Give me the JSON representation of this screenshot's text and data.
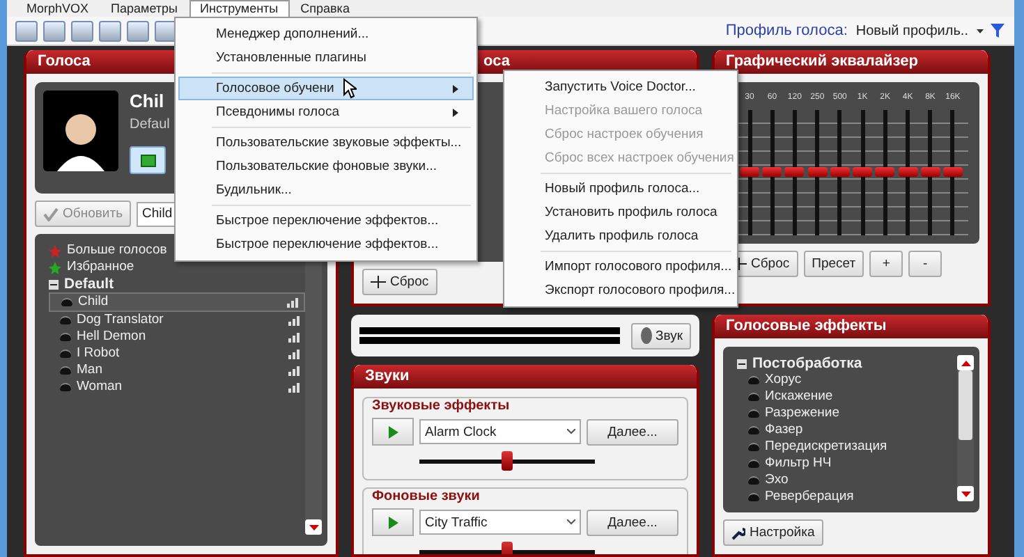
{
  "menubar": [
    {
      "label": "MorphVOX",
      "selected": false
    },
    {
      "label": "Параметры",
      "selected": false
    },
    {
      "label": "Инструменты",
      "selected": true
    },
    {
      "label": "Справка",
      "selected": false
    }
  ],
  "toolbar": {
    "profile_label": "Профиль голоса:",
    "profile_value": "Новый профиль.."
  },
  "voices_panel": {
    "title": "Голоса",
    "voice_name": "Chil",
    "voice_group": "Defaul",
    "update_button": "Обновить",
    "voice_select": "Child",
    "list": [
      {
        "kind": "link",
        "label": "Больше голосов",
        "color": "#cc2222"
      },
      {
        "kind": "link",
        "label": "Избранное",
        "color": "#22aa22"
      },
      {
        "kind": "group",
        "label": "Default",
        "expanded": true,
        "children": [
          {
            "label": "Child",
            "selected": true
          },
          {
            "label": "Dog Translator",
            "selected": false
          },
          {
            "label": "Hell Demon",
            "selected": false
          },
          {
            "label": "I Robot",
            "selected": false
          },
          {
            "label": "Man",
            "selected": false
          },
          {
            "label": "Woman",
            "selected": false
          }
        ]
      }
    ]
  },
  "training_panel": {
    "title": "оса",
    "reset_button": "Сброс"
  },
  "sound_meter": {
    "button": "Звук"
  },
  "sounds_panel": {
    "title": "Звуки",
    "groups": [
      {
        "title": "Звуковые эффекты",
        "value": "Alarm Clock",
        "more_button": "Далее...",
        "level": 0.5
      },
      {
        "title": "Фоновые звуки",
        "value": "City Traffic",
        "more_button": "Далее...",
        "level": 0.5
      }
    ]
  },
  "equalizer": {
    "title": "Графический эквалайзер",
    "bands": [
      {
        "label": "30",
        "level": 0.5
      },
      {
        "label": "60",
        "level": 0.5
      },
      {
        "label": "120",
        "level": 0.5
      },
      {
        "label": "250",
        "level": 0.5
      },
      {
        "label": "500",
        "level": 0.5
      },
      {
        "label": "1K",
        "level": 0.5
      },
      {
        "label": "2K",
        "level": 0.5
      },
      {
        "label": "4K",
        "level": 0.5
      },
      {
        "label": "8K",
        "level": 0.5
      },
      {
        "label": "16K",
        "level": 0.5
      }
    ],
    "buttons": [
      {
        "kind": "reset",
        "label": "Сброс"
      },
      {
        "kind": "text",
        "label": "Пресет"
      },
      {
        "kind": "text",
        "label": "+"
      },
      {
        "kind": "text",
        "label": "-"
      }
    ]
  },
  "effects_panel": {
    "title": "Голосовые эффекты",
    "group": {
      "label": "Постобработка",
      "expanded": true,
      "children": [
        "Хорус",
        "Искажение",
        "Разрежение",
        "Фазер",
        "Передискретизация",
        "Фильтр НЧ",
        "Эхо",
        "Реверберация"
      ]
    },
    "settings_button": "Настройка"
  },
  "menu": [
    {
      "kind": "item",
      "label": "Менеджер дополнений...",
      "selected": false,
      "submenu": false
    },
    {
      "kind": "item",
      "label": "Установленные плагины",
      "selected": false,
      "submenu": false
    },
    {
      "kind": "separator"
    },
    {
      "kind": "item",
      "label": "Голосовое обучени",
      "selected": true,
      "submenu": true
    },
    {
      "kind": "item",
      "label": "Псевдонимы голоса",
      "selected": false,
      "submenu": true
    },
    {
      "kind": "separator"
    },
    {
      "kind": "item",
      "label": "Пользовательские звуковые эффекты...",
      "selected": false,
      "submenu": false
    },
    {
      "kind": "item",
      "label": "Пользовательские фоновые звуки...",
      "selected": false,
      "submenu": false
    },
    {
      "kind": "item",
      "label": "Будильник...",
      "selected": false,
      "submenu": false
    },
    {
      "kind": "separator"
    },
    {
      "kind": "item",
      "label": "Быстрое переключение эффектов...",
      "selected": false,
      "submenu": false
    },
    {
      "kind": "item",
      "label": "Быстрое переключение эффектов...",
      "selected": false,
      "submenu": false
    }
  ],
  "submenu": [
    {
      "kind": "item",
      "label": "Запустить Voice Doctor...",
      "disabled": false
    },
    {
      "kind": "item",
      "label": "Настройка вашего голоса",
      "disabled": true
    },
    {
      "kind": "item",
      "label": "Сброс настроек обучения",
      "disabled": true
    },
    {
      "kind": "item",
      "label": "Сброс всех настроек обучения",
      "disabled": true
    },
    {
      "kind": "separator"
    },
    {
      "kind": "item",
      "label": "Новый профиль голоса...",
      "disabled": false
    },
    {
      "kind": "item",
      "label": "Установить профиль голоса",
      "disabled": false
    },
    {
      "kind": "item",
      "label": "Удалить профиль голоса",
      "disabled": false
    },
    {
      "kind": "separator"
    },
    {
      "kind": "item",
      "label": "Импорт голосового профиля...",
      "disabled": false
    },
    {
      "kind": "item",
      "label": "Экспорт голосового профиля...",
      "disabled": false
    }
  ]
}
